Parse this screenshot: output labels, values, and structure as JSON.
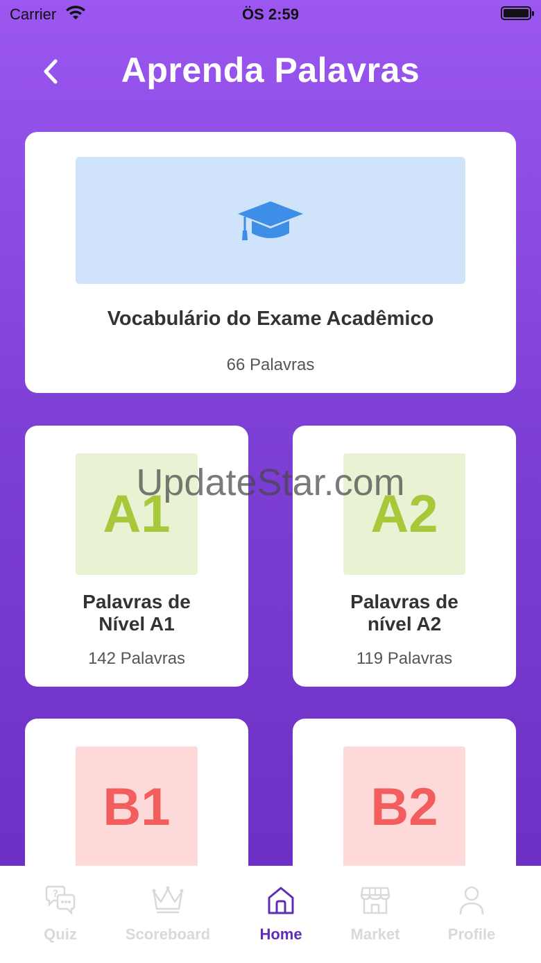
{
  "status_bar": {
    "carrier": "Carrier",
    "time": "ÖS 2:59"
  },
  "header": {
    "title": "Aprenda Palavras"
  },
  "featured": {
    "title": "Vocabulário do Exame Acadêmico",
    "count": "66 Palavras",
    "icon": "graduation-cap-icon",
    "banner_color": "#cfe3fa",
    "icon_color": "#3d8ee6"
  },
  "levels": [
    {
      "code": "A1",
      "title_line1": "Palavras de",
      "title_line2": "Nível A1",
      "count": "142 Palavras"
    },
    {
      "code": "A2",
      "title_line1": "Palavras de",
      "title_line2": "nível A2",
      "count": "119 Palavras"
    },
    {
      "code": "B1"
    },
    {
      "code": "B2"
    }
  ],
  "watermark": "UpdateStar.com",
  "tabs": [
    {
      "label": "Quiz",
      "icon": "chat-bubbles-icon"
    },
    {
      "label": "Scoreboard",
      "icon": "crown-icon"
    },
    {
      "label": "Home",
      "icon": "home-icon",
      "active": true
    },
    {
      "label": "Market",
      "icon": "store-icon"
    },
    {
      "label": "Profile",
      "icon": "user-icon"
    }
  ],
  "colors": {
    "accent": "#5d2db8",
    "bg_top": "#9b57f0",
    "bg_bottom": "#6a2cc0",
    "level_a": "#a6c83a",
    "level_b": "#f25d5d"
  }
}
